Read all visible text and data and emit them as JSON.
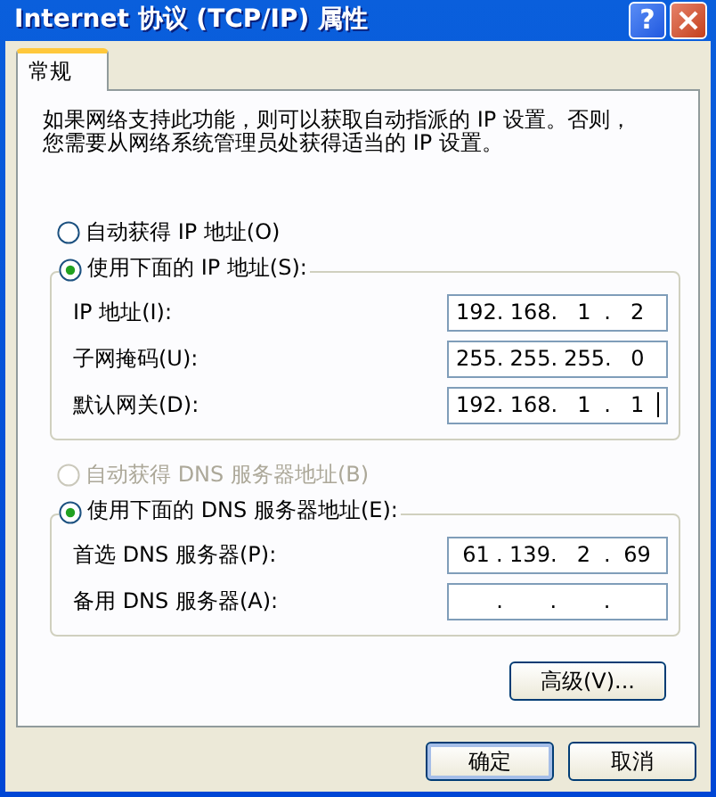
{
  "window": {
    "title": "Internet 协议 (TCP/IP) 属性",
    "help_glyph": "?"
  },
  "tabs": [
    {
      "label": "常规",
      "selected": true
    }
  ],
  "description": [
    "如果网络支持此功能，则可以获取自动指派的 IP 设置。否则，",
    "您需要从网络系统管理员处获得适当的 IP 设置。"
  ],
  "ip_section": {
    "options": [
      {
        "label": "自动获得 IP 地址(O)",
        "selected": false,
        "disabled": false
      },
      {
        "label": "使用下面的 IP 地址(S):",
        "selected": true,
        "disabled": false
      }
    ],
    "fields": [
      {
        "label": "IP 地址(I):",
        "octets": [
          "192",
          "168",
          "1",
          "2"
        ],
        "separator": ".",
        "focused": false
      },
      {
        "label": "子网掩码(U):",
        "octets": [
          "255",
          "255",
          "255",
          "0"
        ],
        "separator": ".",
        "focused": false
      },
      {
        "label": "默认网关(D):",
        "octets": [
          "192",
          "168",
          "1",
          "1"
        ],
        "separator": ".",
        "focused": true
      }
    ]
  },
  "dns_section": {
    "options": [
      {
        "label": "自动获得 DNS 服务器地址(B)",
        "selected": false,
        "disabled": true
      },
      {
        "label": "使用下面的 DNS 服务器地址(E):",
        "selected": true,
        "disabled": false
      }
    ],
    "fields": [
      {
        "label": "首选 DNS 服务器(P):",
        "octets": [
          "61",
          "139",
          "2",
          "69"
        ],
        "separator": ".",
        "focused": false
      },
      {
        "label": "备用 DNS 服务器(A):",
        "separator": ".",
        "focused": false
      }
    ]
  },
  "buttons": {
    "advanced": "高级(V)...",
    "ok": "确定",
    "cancel": "取消"
  }
}
